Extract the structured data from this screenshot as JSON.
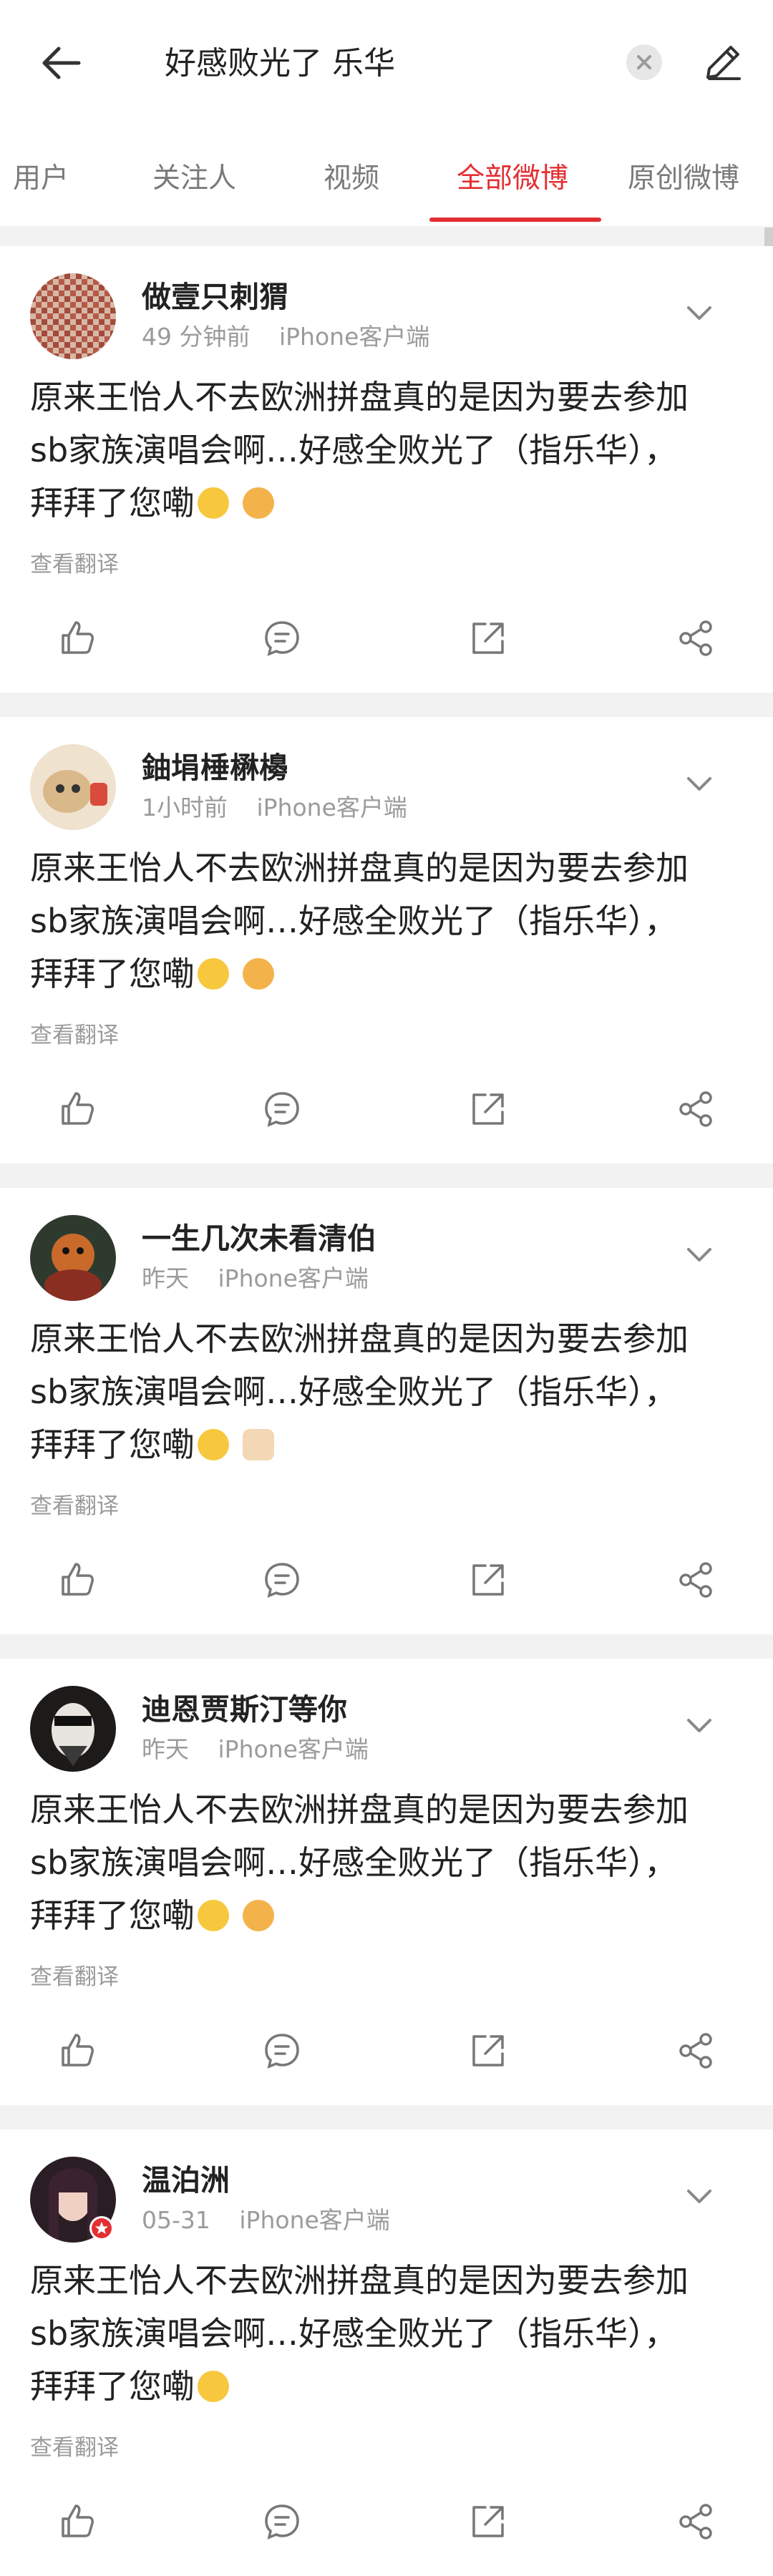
{
  "search": {
    "query": "好感败光了 乐华"
  },
  "tabs": [
    {
      "label": "用户",
      "active": false
    },
    {
      "label": "关注人",
      "active": false
    },
    {
      "label": "视频",
      "active": false
    },
    {
      "label": "全部微博",
      "active": true
    },
    {
      "label": "原创微博",
      "active": false
    }
  ],
  "post_text": {
    "line1": "原来王怡人不去欧洲拼盘真的是因为要去参加",
    "line2": "sb家族演唱会啊…好感全败光了（指乐华），",
    "line3": "拜拜了您嘞"
  },
  "translate_label": "查看翻译",
  "posts": [
    {
      "user": "做壹只刺猬",
      "time": "49 分钟前",
      "source": "iPhone客户端"
    },
    {
      "user": "鈾埍棰楙櫋",
      "time": "1小时前",
      "source": "iPhone客户端"
    },
    {
      "user": "一生几次未看清伯",
      "time": "昨天",
      "source": "iPhone客户端"
    },
    {
      "user": "迪恩贾斯汀等你",
      "time": "昨天",
      "source": "iPhone客户端"
    },
    {
      "user": "温泊洲",
      "time": "05-31",
      "source": "iPhone客户端"
    }
  ],
  "icons": {
    "back": "back-arrow-icon",
    "clear": "clear-icon",
    "edit": "edit-icon",
    "more": "chevron-down-icon",
    "like": "like-icon",
    "comment": "comment-icon",
    "repost": "repost-icon",
    "share": "share-icon"
  },
  "colors": {
    "accent": "#e32f33",
    "background": "#f2f2f2",
    "muted_text": "#9b9b9b"
  }
}
